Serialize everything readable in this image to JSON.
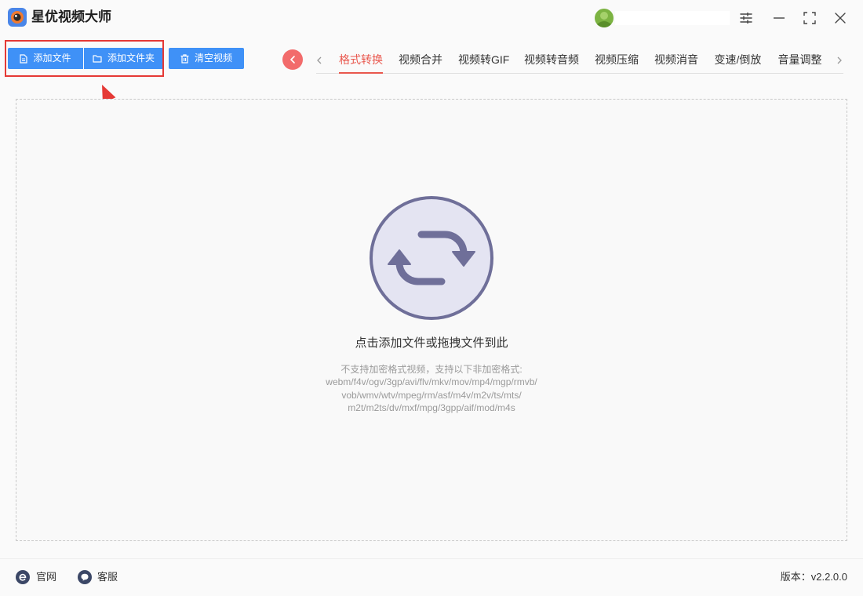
{
  "app": {
    "title": "星优视频大师",
    "logo_icon": "app-logo-icon"
  },
  "titlebar": {
    "avatar_icon": "user-avatar",
    "controls": [
      "settings-icon",
      "minimize-icon",
      "maximize-icon",
      "close-icon"
    ]
  },
  "toolbar": {
    "add_file": {
      "label": "添加文件",
      "icon": "file-icon"
    },
    "add_folder": {
      "label": "添加文件夹",
      "icon": "folder-icon"
    },
    "clear": {
      "label": "清空视频",
      "icon": "trash-icon"
    }
  },
  "tabs": {
    "back_icon": "chevron-left-icon",
    "items": [
      {
        "label": "格式转换",
        "active": true
      },
      {
        "label": "视频合并",
        "active": false
      },
      {
        "label": "视频转GIF",
        "active": false
      },
      {
        "label": "视频转音频",
        "active": false
      },
      {
        "label": "视频压缩",
        "active": false
      },
      {
        "label": "视频消音",
        "active": false
      },
      {
        "label": "变速/倒放",
        "active": false
      },
      {
        "label": "音量调整",
        "active": false
      }
    ]
  },
  "dropzone": {
    "icon": "convert-sync-icon",
    "prompt": "点击添加文件或拖拽文件到此",
    "notice": "不支持加密格式视频，支持以下非加密格式:",
    "formats": [
      "webm/f4v/ogv/3gp/avi/flv/mkv/mov/mp4/mgp/rmvb/",
      "vob/wmv/wtv/mpeg/rm/asf/m4v/m2v/ts/mts/",
      "m2t/m2ts/dv/mxf/mpg/3gpp/aif/mod/m4s"
    ]
  },
  "footer": {
    "website": {
      "label": "官网",
      "icon": "website-e-icon"
    },
    "support": {
      "label": "客服",
      "icon": "chat-bubble-icon"
    },
    "version": "版本：v2.2.0.0"
  },
  "colors": {
    "accent_blue": "#3f91f7",
    "active_tab": "#e9574d",
    "back_button": "#f26b6b",
    "annotation_red": "#e53935",
    "convert_icon": "#6f6f99",
    "convert_circle_fill": "#e4e4f2"
  }
}
